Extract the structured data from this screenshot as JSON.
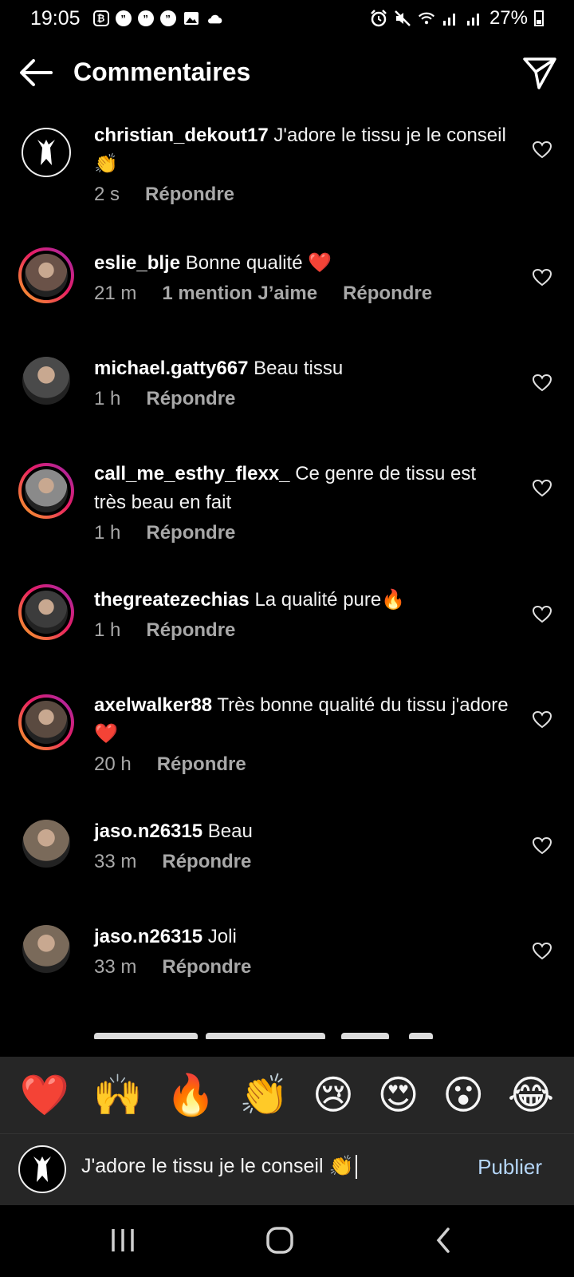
{
  "status_bar": {
    "time": "19:05",
    "battery": "27%",
    "left_icons": [
      "bitcoin-app-icon",
      "quote-icon",
      "quote-icon",
      "quote-icon",
      "gallery-icon",
      "cloud-icon"
    ],
    "right_icons": [
      "alarm-icon",
      "mute-icon",
      "wifi-icon",
      "signal-icon",
      "signal-icon",
      "battery-icon"
    ]
  },
  "header": {
    "title": "Commentaires",
    "back_icon": "arrow-left-icon",
    "share_icon": "send-icon"
  },
  "comments": [
    {
      "username": "christian_dekout17",
      "text": "J'adore le tissu je le conseil 👏",
      "time": "2 s",
      "likes": "",
      "reply_label": "Répondre",
      "avatar": "brand-logo",
      "story_ring": false
    },
    {
      "username": "eslie_blje",
      "text": "Bonne qualité ❤️",
      "time": "21 m",
      "likes": "1 mention J’aime",
      "reply_label": "Répondre",
      "avatar": "photo",
      "story_ring": true
    },
    {
      "username": "michael.gatty667",
      "text": "Beau tissu",
      "time": "1 h",
      "likes": "",
      "reply_label": "Répondre",
      "avatar": "photo",
      "story_ring": false
    },
    {
      "username": "call_me_esthy_flexx_",
      "text": "Ce genre de tissu est très beau en fait",
      "time": "1 h",
      "likes": "",
      "reply_label": "Répondre",
      "avatar": "photo",
      "story_ring": true
    },
    {
      "username": "thegreatezechias",
      "text": "La qualité pure🔥",
      "time": "1 h",
      "likes": "",
      "reply_label": "Répondre",
      "avatar": "photo",
      "story_ring": true
    },
    {
      "username": "axelwalker88",
      "text": "Très bonne qualité du tissu j'adore ❤️",
      "time": "20 h",
      "likes": "",
      "reply_label": "Répondre",
      "avatar": "photo",
      "story_ring": true
    },
    {
      "username": "jaso.n26315",
      "text": "Beau",
      "time": "33 m",
      "likes": "",
      "reply_label": "Répondre",
      "avatar": "photo",
      "story_ring": false
    },
    {
      "username": "jaso.n26315",
      "text": "Joli",
      "time": "33 m",
      "likes": "",
      "reply_label": "Répondre",
      "avatar": "photo",
      "story_ring": false
    }
  ],
  "emoji_reactions": [
    "❤️",
    "🙌",
    "🔥",
    "👏",
    "😢",
    "😍",
    "😮",
    "😂"
  ],
  "composer": {
    "input_value": "J'adore le tissu je le conseil 👏",
    "publish_label": "Publier"
  },
  "nav": [
    "recent-apps-icon",
    "home-icon",
    "back-icon"
  ],
  "colors": {
    "background": "#000000",
    "muted_text": "#a8a8a8",
    "publish_blue": "#b5d6f9",
    "panel": "#262626"
  }
}
